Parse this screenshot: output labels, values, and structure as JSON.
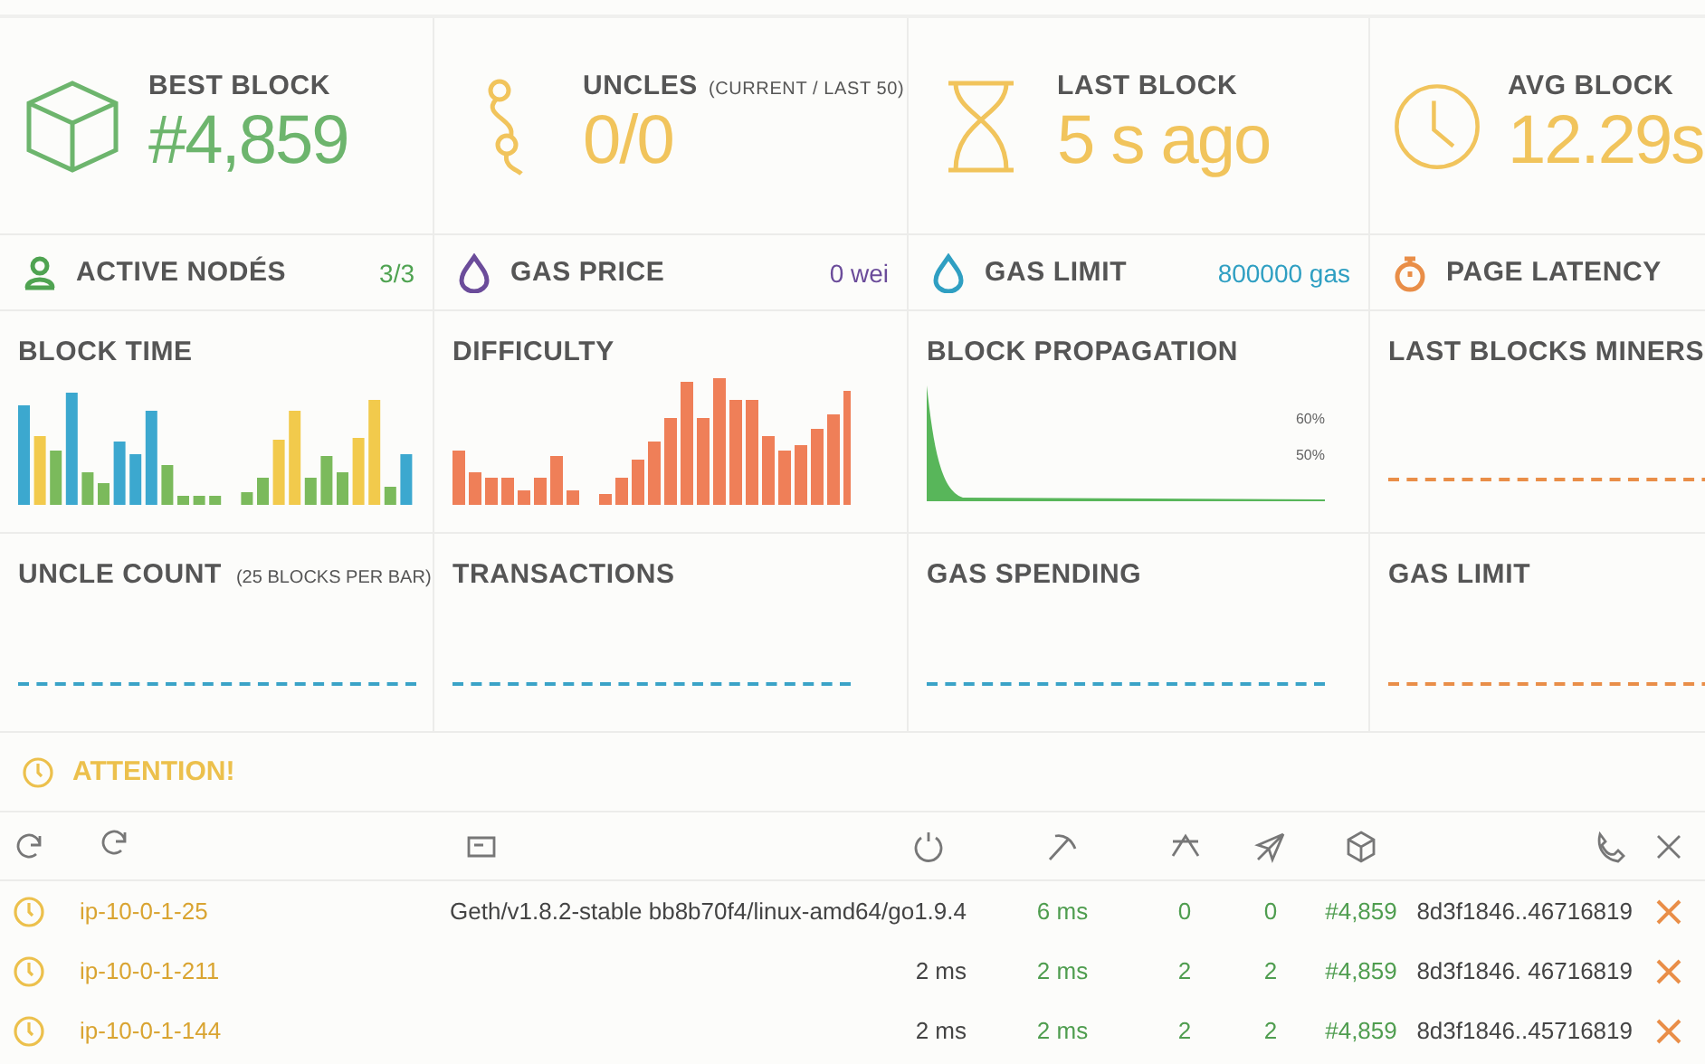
{
  "stats": [
    {
      "kind": "cube",
      "label": "BEST BLOCK",
      "value": "#4,859",
      "color": "#6db56d"
    },
    {
      "kind": "uncles",
      "label": "UNCLES",
      "note": "(CURRENT / LAST 50)",
      "value": "0/0",
      "color": "#f1c45c"
    },
    {
      "kind": "hourglass",
      "label": "LAST BLOCK",
      "value": "5 s ago",
      "color": "#f1c45c"
    },
    {
      "kind": "clock",
      "label": "AVG BLOCK",
      "value": "12.29s",
      "color": "#f1c45c"
    }
  ],
  "summary": [
    {
      "kind": "person",
      "label": "ACTIVE NODÉS",
      "value": "3/3",
      "color": "#4fa351"
    },
    {
      "kind": "drop",
      "label": "GAS PRICE",
      "value": "0 wei",
      "color": "#6b4c9a"
    },
    {
      "kind": "drop",
      "label": "GAS LIMIT",
      "value": "800000 gas",
      "color": "#2f9fc2"
    },
    {
      "kind": "timer",
      "label": "PAGE LATENCY",
      "color": "#e98e48"
    }
  ],
  "charts": [
    {
      "kind": "multibars",
      "title": "BLOCK TIME"
    },
    {
      "kind": "bars",
      "title": "DIFFICULTY"
    },
    {
      "kind": "propagation",
      "title": "BLOCK PROPAGATION",
      "labels": [
        "60%",
        "50%"
      ]
    },
    {
      "kind": "dashed",
      "title": "LAST BLOCKS MINERS",
      "color": "#e98e48"
    },
    {
      "kind": "dashed",
      "title": "UNCLE COUNT",
      "note": "(25 BLOCKS PER BAR)",
      "color": "#3aa3c7"
    },
    {
      "kind": "dashed",
      "title": "TRANSACTIONS",
      "color": "#3aa3c7"
    },
    {
      "kind": "dashed",
      "title": "GAS SPENDING",
      "color": "#3aa3c7"
    },
    {
      "kind": "dashed",
      "title": "GAS LIMIT",
      "color": "#e98e48"
    }
  ],
  "attention": {
    "label": "ATTENTION!"
  },
  "rows": [
    {
      "column_2": "ip-10-0-1-25",
      "column_3": "Geth/v1.8.2-stable bb8b70f4/linux-amd64/go1.9.4",
      "column_4": "6 ms",
      "column_5": "0",
      "column_6": "0",
      "column_7": "#4,859",
      "column_8": "8d3f1846..46716819"
    },
    {
      "column_2": "ip-10-0-1-211",
      "column_3": "2 ms",
      "column_4": "2 ms",
      "column_5": "2",
      "column_6": "2",
      "column_7": "#4,859",
      "column_8": "8d3f1846. 46716819"
    },
    {
      "column_2": "ip-10-0-1-144",
      "column_3": "2 ms",
      "column_4": "2 ms",
      "column_5": "2",
      "column_6": "2",
      "column_7": "#4,859",
      "column_8": "8d3f1846..45716819"
    }
  ]
}
